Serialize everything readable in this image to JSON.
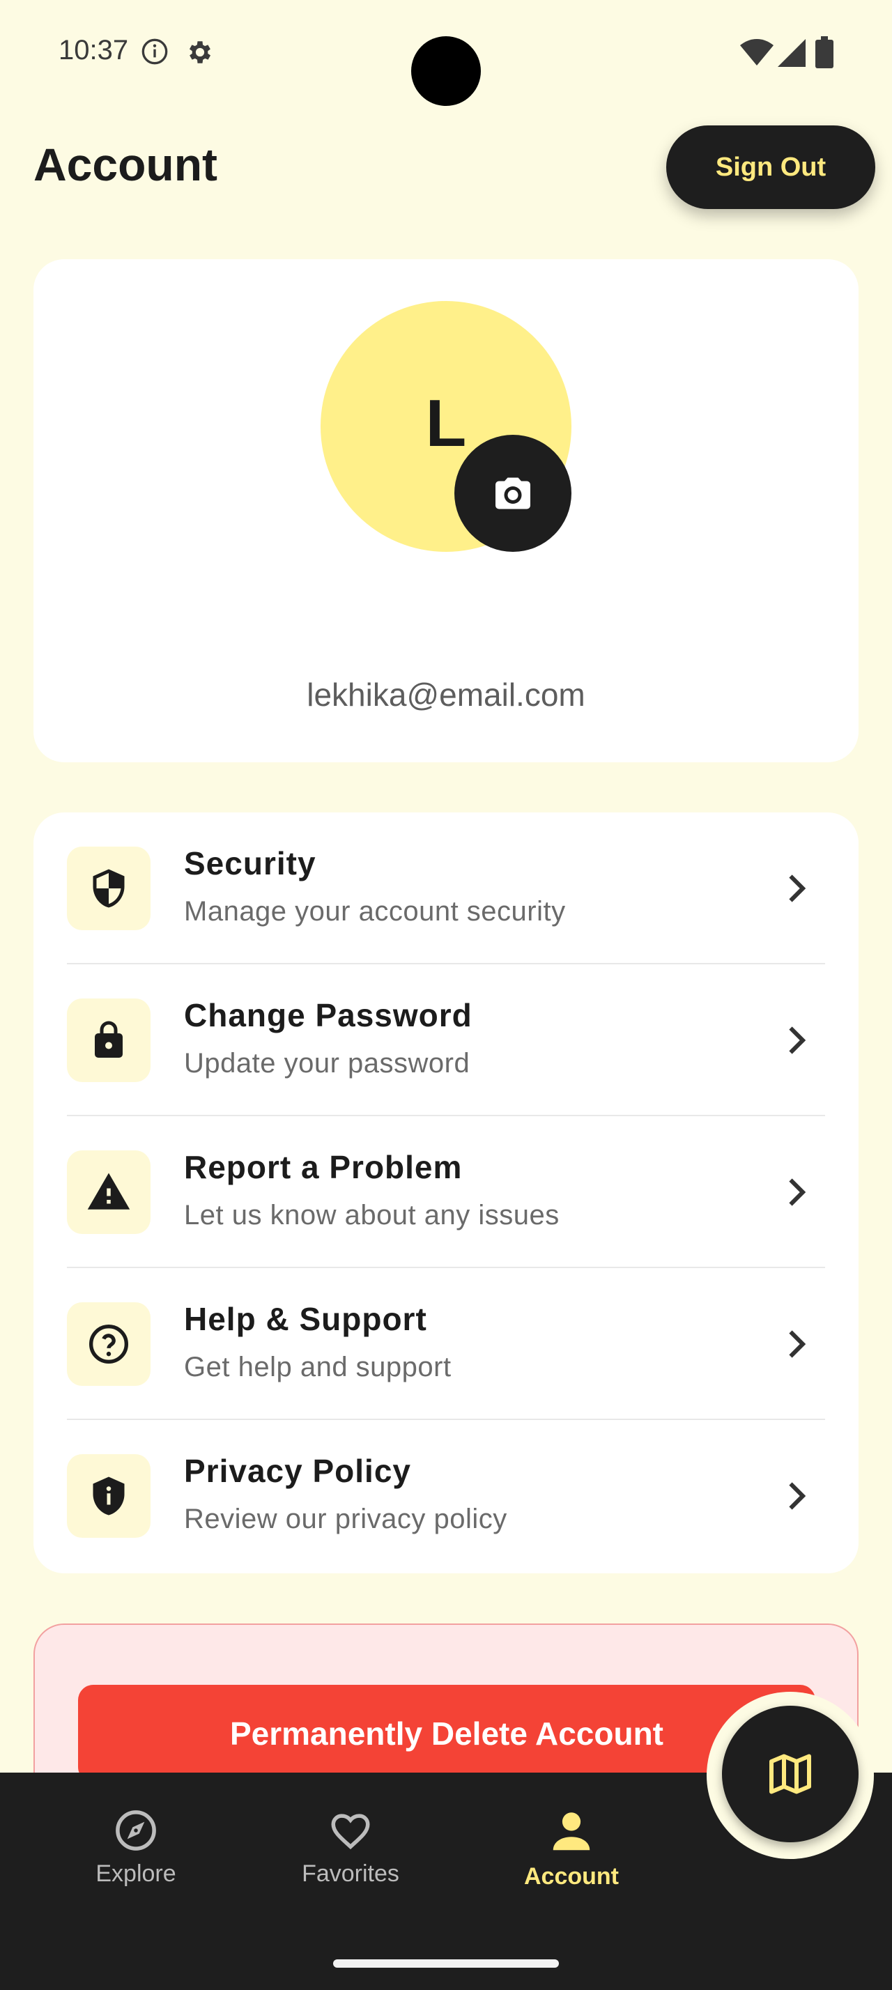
{
  "status_bar": {
    "time": "10:37",
    "icons_left": [
      "info-icon",
      "gear-icon"
    ],
    "icons_right": [
      "wifi-icon",
      "signal-icon",
      "battery-icon"
    ]
  },
  "header": {
    "title": "Account",
    "sign_out_label": "Sign Out"
  },
  "profile": {
    "avatar_letter": "L",
    "email": "lekhika@email.com",
    "camera_icon": "camera-icon"
  },
  "menu": {
    "items": [
      {
        "icon": "shield-icon",
        "title": "Security",
        "subtitle": "Manage your account security"
      },
      {
        "icon": "lock-icon",
        "title": "Change Password",
        "subtitle": "Update your password"
      },
      {
        "icon": "warning-icon",
        "title": "Report a Problem",
        "subtitle": "Let us know about any issues"
      },
      {
        "icon": "help-icon",
        "title": "Help & Support",
        "subtitle": "Get help and support"
      },
      {
        "icon": "privacy-shield-icon",
        "title": "Privacy Policy",
        "subtitle": "Review our privacy policy"
      }
    ]
  },
  "danger": {
    "delete_label": "Permanently Delete Account"
  },
  "bottom_nav": {
    "items": [
      {
        "icon": "compass-icon",
        "label": "Explore"
      },
      {
        "icon": "heart-icon",
        "label": "Favorites"
      },
      {
        "icon": "person-icon",
        "label": "Account",
        "active": true
      }
    ],
    "fab_icon": "map-icon"
  },
  "colors": {
    "background": "#FDFBE3",
    "accent": "#FFE97F",
    "avatar": "#FFF08A",
    "dark": "#1E1E1E",
    "danger": "#F44336",
    "danger_bg": "#FEE8E8"
  }
}
